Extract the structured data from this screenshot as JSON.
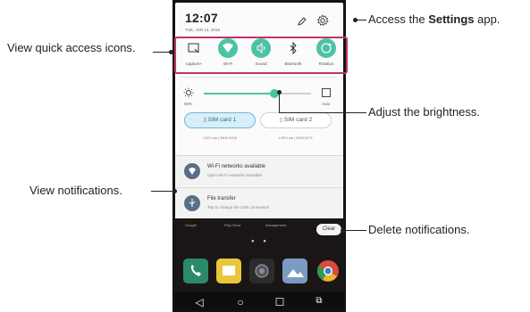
{
  "status": {
    "time": "12:07",
    "date": "TUE, JUN 14, 2016"
  },
  "quick_access": [
    {
      "label": "Capture+",
      "icon": "capture-icon",
      "on": false
    },
    {
      "label": "Wi-Fi",
      "icon": "wifi-icon",
      "on": true
    },
    {
      "label": "Sound",
      "icon": "sound-icon",
      "on": true
    },
    {
      "label": "Bluetooth",
      "icon": "bluetooth-icon",
      "on": false
    },
    {
      "label": "Rotation",
      "icon": "rotation-icon",
      "on": true
    }
  ],
  "brightness": {
    "percent_label": "66%",
    "auto_label": "Auto",
    "level": 0.66
  },
  "sim_cards": [
    {
      "label": "SIM card 1",
      "carrier": "LGE Lab | 3400 6159",
      "selected": true
    },
    {
      "label": "SIM card 2",
      "carrier": "LGE Lab | 3400 6171",
      "selected": false
    }
  ],
  "notifications": [
    {
      "title": "Wi-Fi networks available",
      "subtitle": "Open Wi-Fi networks available",
      "icon": "wifi-notification-icon"
    },
    {
      "title": "File transfer",
      "subtitle": "Tap to change the USB connection",
      "icon": "usb-icon"
    }
  ],
  "home_labels": [
    "Google",
    "Play Store",
    "Management"
  ],
  "clear_label": "Clear",
  "nav": {
    "back": "◁",
    "home": "○",
    "recents": "☐",
    "extra": "⧉"
  },
  "callouts": {
    "settings_prefix": "Access the ",
    "settings_bold": "Settings",
    "settings_suffix": " app.",
    "quick_access": "View quick access icons.",
    "brightness": "Adjust the brightness.",
    "notifications": "View notifications.",
    "delete": "Delete notifications."
  },
  "colors": {
    "accent": "#4cc2a6",
    "highlight": "#c0326a",
    "sim_selected": "#d8eef8"
  }
}
